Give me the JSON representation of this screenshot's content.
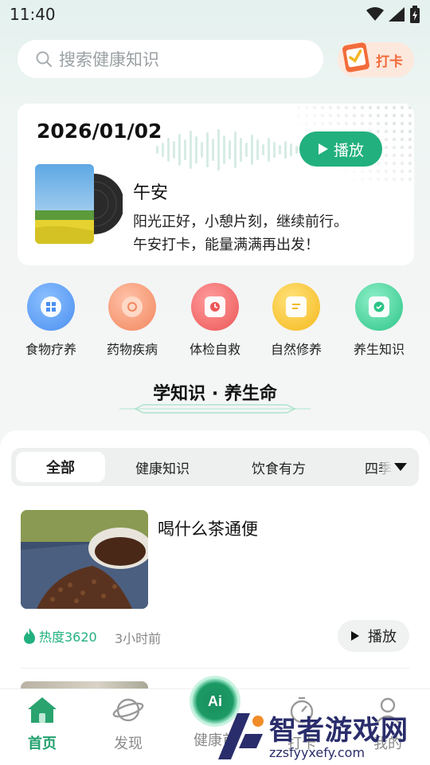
{
  "status_bar": {
    "time": "11:40"
  },
  "search": {
    "placeholder": "搜索健康知识"
  },
  "checkin": {
    "label": "打卡"
  },
  "daily": {
    "date": "2026/01/02",
    "play_label": "播放",
    "title": "午安",
    "lines": [
      "阳光正好，小憩片刻，继续前行。",
      "午安打卡，能量满满再出发！"
    ]
  },
  "categories": [
    {
      "label": "食物疗养",
      "color": "#5b9ff2"
    },
    {
      "label": "药物疾病",
      "color": "#f59a7a"
    },
    {
      "label": "体检自救",
      "color": "#f06a6a"
    },
    {
      "label": "自然修养",
      "color": "#f5c026"
    },
    {
      "label": "养生知识",
      "color": "#3ccf96"
    }
  ],
  "section": {
    "title": "学知识 · 养生命"
  },
  "tabs": [
    "全部",
    "健康知识",
    "饮食有方",
    "四季"
  ],
  "articles": [
    {
      "title": "喝什么茶通便",
      "hot": "热度3620",
      "time": "3小时前",
      "play_label": "播放"
    }
  ],
  "bottom_nav": [
    {
      "label": "首页",
      "active": true
    },
    {
      "label": "发现",
      "active": false
    },
    {
      "label": "健康首",
      "active": false
    },
    {
      "label": "打卡",
      "active": false
    },
    {
      "label": "我的",
      "active": false
    }
  ],
  "ai_badge": "Ai",
  "watermark": {
    "text": "智者游戏网",
    "url": "zzsfyyxefy.com"
  },
  "colors": {
    "accent": "#22b07e",
    "checkin": "#f26b3a"
  }
}
